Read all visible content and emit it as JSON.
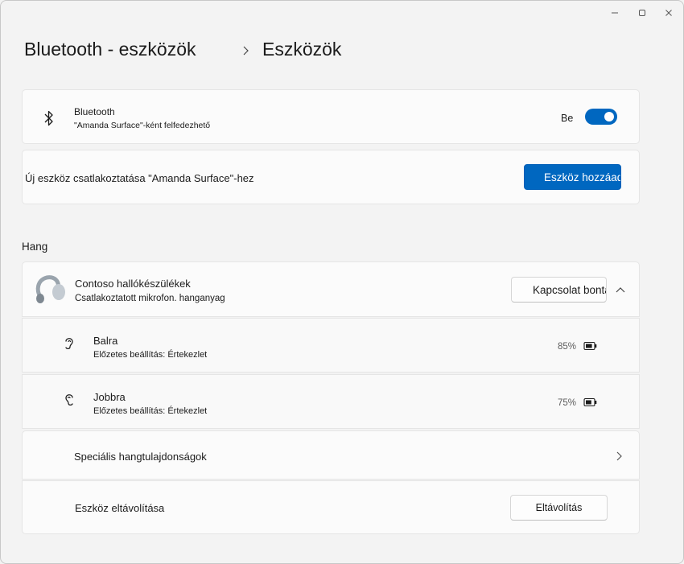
{
  "breadcrumb": {
    "parent": "Bluetooth - eszközök",
    "current": "Eszközök"
  },
  "bluetooth_card": {
    "title": "Bluetooth",
    "subtitle": "\"Amanda Surface\"-ként felfedezhető",
    "toggle_state": "Be",
    "toggle_on": true
  },
  "add_device_card": {
    "text": "Új eszköz csatlakoztatása \"Amanda Surface\"-hez",
    "button_label": "Eszköz hozzáadása"
  },
  "section_label": "Hang",
  "device": {
    "name": "Contoso hallókészülékek",
    "status": "Csatlakoztatott mikrofon. hanganyag",
    "disconnect_label": "Kapcsolat bontása"
  },
  "sub_devices": [
    {
      "name": "Balra",
      "preset": "Előzetes beállítás: Értekezlet",
      "battery": "85%",
      "battery_level": 0.85
    },
    {
      "name": "Jobbra",
      "preset": "Előzetes beállítás: Értekezlet",
      "battery": "75%",
      "battery_level": 0.75
    }
  ],
  "special_audio": {
    "label": "Speciális hangtulajdonságok"
  },
  "remove_device": {
    "label": "Eszköz eltávolítása",
    "button_label": "Eltávolítás"
  },
  "colors": {
    "accent": "#0067c0",
    "background": "#f3f3f3",
    "card": "#fbfbfb"
  }
}
